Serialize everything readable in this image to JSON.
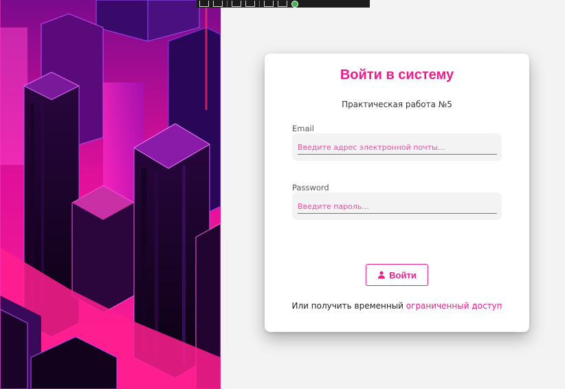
{
  "colors": {
    "accent": "#e91e8c",
    "placeholder": "#e0559f",
    "field_bg": "#f3f3f3",
    "page_bg": "#f3f3f3"
  },
  "art_panel": {
    "icon": "neon-city-illustration"
  },
  "debug_toolbar": {
    "icons": [
      "select-element-icon",
      "display-layout-icon",
      "track-focus-icon",
      "pointer-icon",
      "hot-reload-ok-icon"
    ]
  },
  "login": {
    "title": "Войти в систему",
    "subtitle": "Практическая работа №5",
    "email": {
      "label": "Email",
      "value": "",
      "placeholder": "Введите адрес электронной почты..."
    },
    "password": {
      "label": "Password",
      "value": "",
      "placeholder": "Введите пароль..."
    },
    "submit_label": "Войти",
    "submit_icon": "user-icon",
    "footer_text": "Или получить временный ",
    "footer_link": "ограниченный доступ"
  }
}
